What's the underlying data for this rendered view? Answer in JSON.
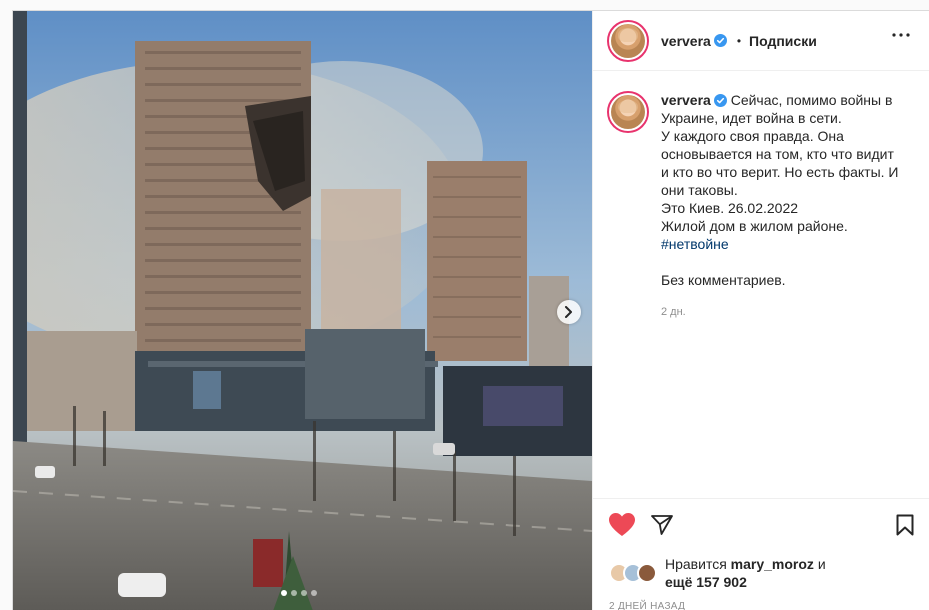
{
  "post": {
    "username": "ververa",
    "follow_label": "Подписки",
    "bullet": "•",
    "caption_lines": [
      "Сейчас, помимо войны в",
      "Украине, идет война в сети.",
      "У каждого своя правда. Она",
      "основывается на том, кто что видит",
      "и кто во что верит. Но есть факты. И",
      "они таковы.",
      "Это Киев. 26.02.2022",
      "Жилой дом в жилом районе."
    ],
    "hashtag": "#нетвойне",
    "closing_text": "Без комментариев.",
    "time_ago": "2 дн.",
    "likes": {
      "prefix": "Нравится",
      "liker": "mary_moroz",
      "and_word": "и",
      "more_label": "ещё 157 902"
    },
    "posted_label": "2 ДНЕЙ НАЗАД",
    "carousel": {
      "total": 4,
      "current": 1
    }
  },
  "colors": {
    "like_red": "#ed4956",
    "verified_blue": "#3897f0",
    "hashtag_blue": "#00376b",
    "muted_gray": "#8e8e8e",
    "story_ring": "#e8336d"
  },
  "icons": [
    "verified-badge-icon",
    "more-options-icon",
    "heart-icon",
    "share-icon",
    "bookmark-icon",
    "chevron-right-icon"
  ]
}
